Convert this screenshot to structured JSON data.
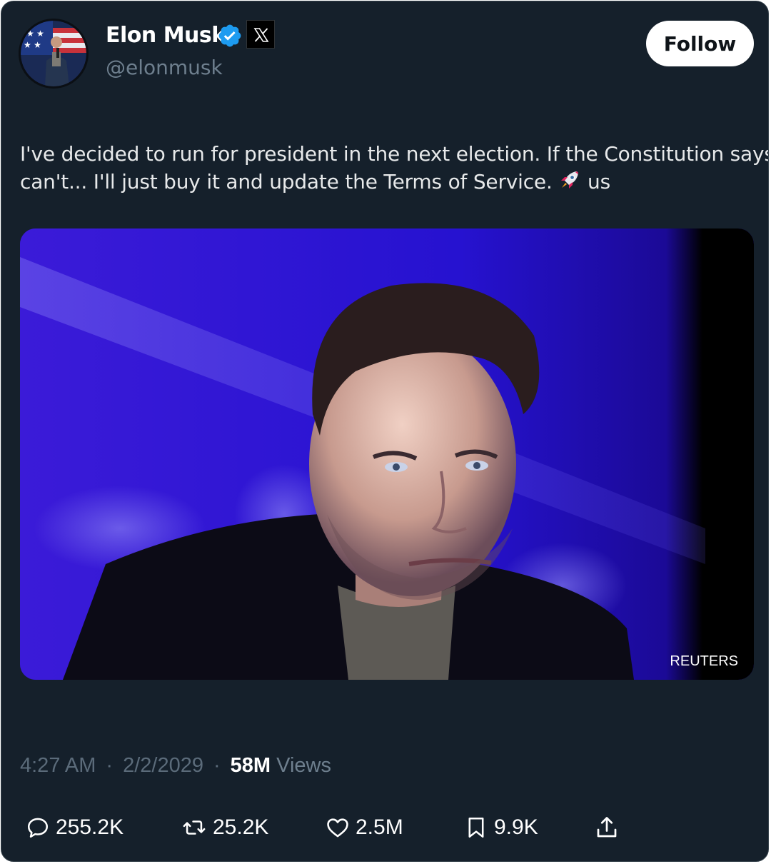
{
  "author": {
    "name": "Elon Musk",
    "handle": "@elonmusk",
    "verified": true,
    "affiliate_badge_icon": "x-logo-icon"
  },
  "follow_button": {
    "label": "Follow"
  },
  "tweet": {
    "text_line1": "I've decided to run for president in the next election. If the Constitution says I",
    "text_line2_before": "can't... I'll just buy it and update the Terms of Service. ",
    "emoji": "rocket-icon",
    "text_line2_after": " us"
  },
  "media": {
    "credit": "REUTERS",
    "background_color": "#2a10c8"
  },
  "meta": {
    "time": "4:27 AM",
    "separator": "·",
    "date": "2/2/2029",
    "views_count": "58M",
    "views_label": "Views"
  },
  "actions": {
    "replies": "255.2K",
    "reposts": "25.2K",
    "likes": "2.5M",
    "bookmarks": "9.9K"
  },
  "colors": {
    "background": "#15202b",
    "verified_blue": "#1d9bf0",
    "muted_text": "#6e7f8e"
  }
}
